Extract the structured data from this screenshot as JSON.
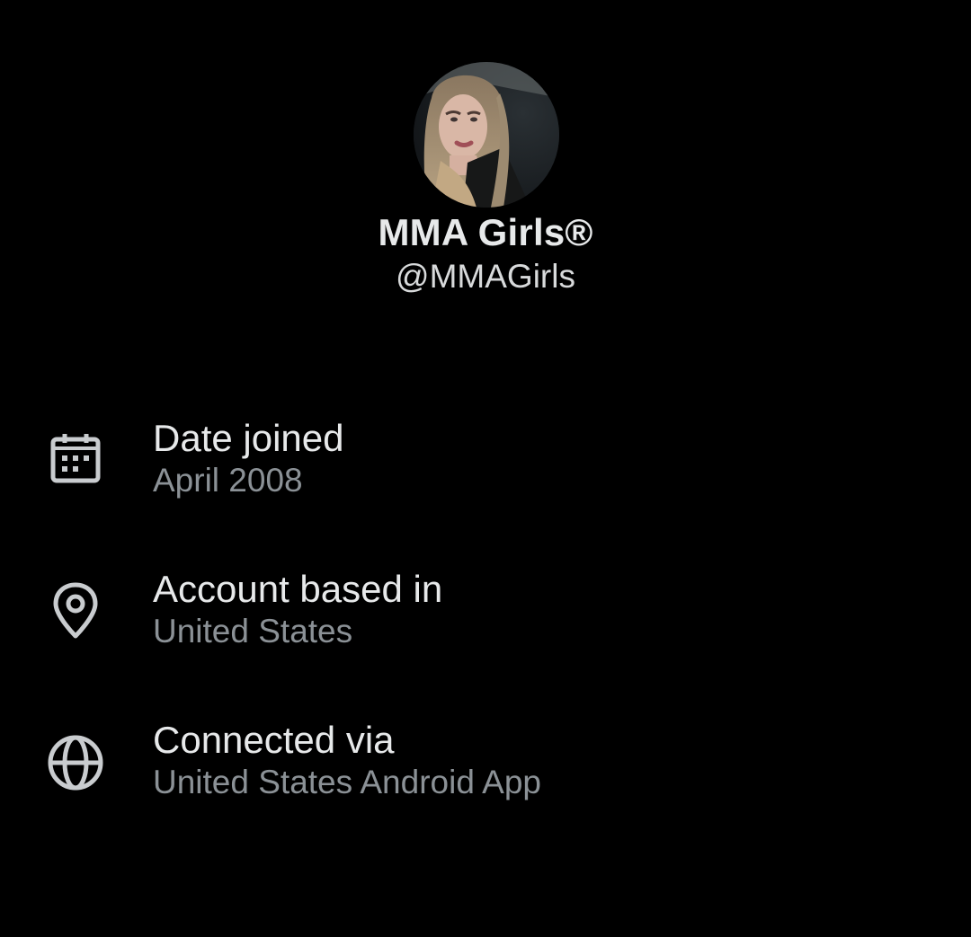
{
  "profile": {
    "display_name": "MMA Girls®",
    "handle": "@MMAGirls",
    "avatar_alt": "profile-photo"
  },
  "about": {
    "rows": [
      {
        "icon": "calendar-icon",
        "label": "Date joined",
        "value": "April 2008"
      },
      {
        "icon": "location-pin-icon",
        "label": "Account based in",
        "value": "United States"
      },
      {
        "icon": "globe-icon",
        "label": "Connected via",
        "value": "United States Android App"
      }
    ]
  },
  "colors": {
    "background": "#000000",
    "primary_text": "#e7e9ea",
    "secondary_text": "#8b9196",
    "icon": "#c9cccf"
  }
}
